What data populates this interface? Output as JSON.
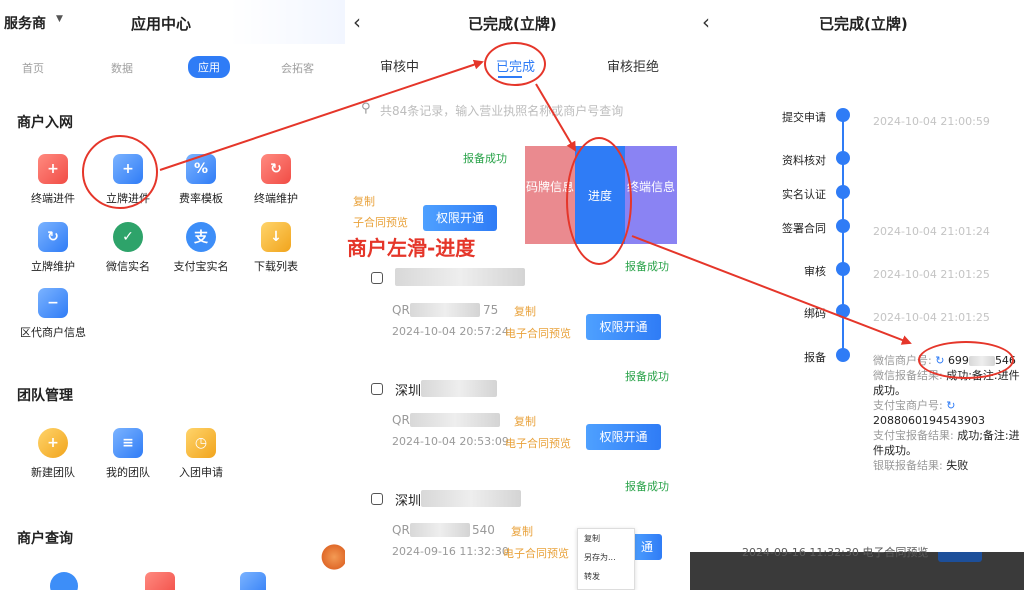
{
  "colors": {
    "accent": "#2f7cf6",
    "annotation": "#e5362a",
    "green": "#2aa34a",
    "orange": "#e9a23b"
  },
  "panel1": {
    "provider": "服务商",
    "title": "应用中心",
    "tabs": [
      "首页",
      "数据",
      "应用",
      "会拓客"
    ],
    "sections": {
      "merchant_in": "商户入网",
      "team": "团队管理",
      "query": "商户查询"
    },
    "apps": [
      "终端进件",
      "立牌进件",
      "费率模板",
      "终端维护",
      "立牌维护",
      "微信实名",
      "支付宝实名",
      "下载列表",
      "区代商户信息"
    ],
    "team_apps": [
      "新建团队",
      "我的团队",
      "入团申请"
    ]
  },
  "panel2": {
    "title": "已完成(立牌)",
    "tabs": [
      "审核中",
      "已完成",
      "审核拒绝"
    ],
    "search_placeholder": "共84条记录，输入营业执照名称或商户号查询",
    "annotation": "商户左滑-进度",
    "swipe": {
      "left": "码牌信息",
      "mid": "进度",
      "right": "终端信息"
    },
    "top_item": {
      "status": "报备成功",
      "copy": "复制",
      "contract": "子合同预览",
      "button": "权限开通"
    },
    "records": [
      {
        "status": "报备成功",
        "name_start": "",
        "name_end": "",
        "code_prefix": "QR",
        "code_suffix": "75",
        "copy": "复制",
        "time": "2024-10-04 20:57:24",
        "contract": "电子合同预览",
        "button": "权限开通"
      },
      {
        "status": "报备成功",
        "name_start": "深圳",
        "name_end": "",
        "code_prefix": "QR",
        "code_suffix": "",
        "copy": "复制",
        "time": "2024-10-04 20:53:09",
        "contract": "电子合同预览",
        "button": "权限开通"
      },
      {
        "status": "报备成功",
        "name_start": "深圳",
        "name_end": "",
        "code_prefix": "QR",
        "code_suffix": "540",
        "copy": "复制",
        "time": "2024-09-16 11:32:30",
        "contract": "电子合同预览",
        "button": "通"
      }
    ],
    "context_menu": [
      "复制",
      "另存为...",
      "转发"
    ]
  },
  "panel3": {
    "title": "已完成(立牌)",
    "steps": [
      {
        "label": "提交申请",
        "time": "2024-10-04 21:00:59"
      },
      {
        "label": "资料核对",
        "time": ""
      },
      {
        "label": "实名认证",
        "time": ""
      },
      {
        "label": "签署合同",
        "time": "2024-10-04 21:01:24"
      },
      {
        "label": "审核",
        "time": "2024-10-04 21:01:25"
      },
      {
        "label": "绑码",
        "time": "2024-10-04 21:01:25"
      },
      {
        "label": "报备",
        "time": ""
      }
    ],
    "detail": {
      "wx_label": "微信商户号:",
      "wx_value_start": "699",
      "wx_value_end": "546",
      "wx_result_label": "微信报备结果:",
      "wx_result": "成功;备注:进件成功。",
      "ali_label": "支付宝商户号:",
      "ali_value": "2088060194543903",
      "ali_result_label": "支付宝报备结果:",
      "ali_result": "成功;备注:进件成功。",
      "union_label": "银联报备结果:",
      "union_result": "失败"
    },
    "bottom_ghost": "2024-09-16 11:32:30  电子合同预览"
  }
}
